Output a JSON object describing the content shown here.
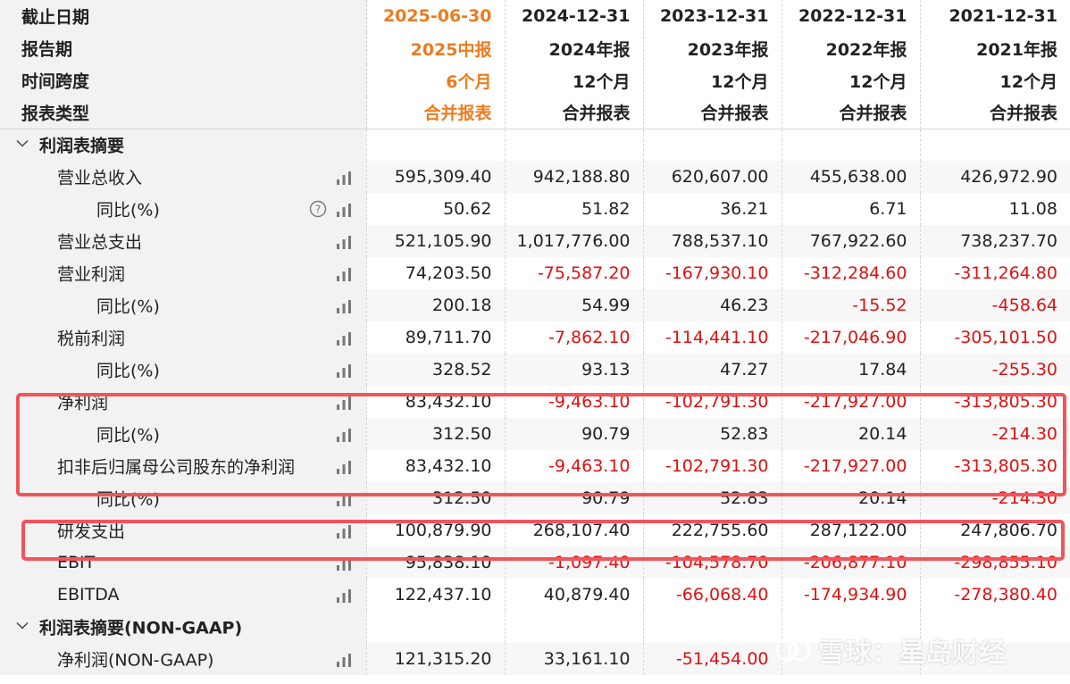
{
  "header_rows": [
    {
      "label": "截止日期",
      "values": [
        "2025-06-30",
        "2024-12-31",
        "2023-12-31",
        "2022-12-31",
        "2021-12-31"
      ]
    },
    {
      "label": "报告期",
      "values": [
        "2025中报",
        "2024年报",
        "2023年报",
        "2022年报",
        "2021年报"
      ]
    },
    {
      "label": "时间跨度",
      "values": [
        "6个月",
        "12个月",
        "12个月",
        "12个月",
        "12个月"
      ]
    },
    {
      "label": "报表类型",
      "values": [
        "合并报表",
        "合并报表",
        "合并报表",
        "合并报表",
        "合并报表"
      ]
    }
  ],
  "sections": [
    {
      "title": "利润表摘要",
      "rows": [
        {
          "label": "营业总收入",
          "level": 1,
          "values": [
            "595,309.40",
            "942,188.80",
            "620,607.00",
            "455,638.00",
            "426,972.90"
          ]
        },
        {
          "label": "同比(%)",
          "level": 2,
          "help": true,
          "values": [
            "50.62",
            "51.82",
            "36.21",
            "6.71",
            "11.08"
          ]
        },
        {
          "label": "营业总支出",
          "level": 1,
          "values": [
            "521,105.90",
            "1,017,776.00",
            "788,537.10",
            "767,922.60",
            "738,237.70"
          ]
        },
        {
          "label": "营业利润",
          "level": 1,
          "values": [
            "74,203.50",
            "-75,587.20",
            "-167,930.10",
            "-312,284.60",
            "-311,264.80"
          ]
        },
        {
          "label": "同比(%)",
          "level": 2,
          "values": [
            "200.18",
            "54.99",
            "46.23",
            "-15.52",
            "-458.64"
          ]
        },
        {
          "label": "税前利润",
          "level": 1,
          "values": [
            "89,711.70",
            "-7,862.10",
            "-114,441.10",
            "-217,046.90",
            "-305,101.50"
          ]
        },
        {
          "label": "同比(%)",
          "level": 2,
          "values": [
            "328.52",
            "93.13",
            "47.27",
            "17.84",
            "-255.30"
          ]
        },
        {
          "label": "净利润",
          "level": 1,
          "values": [
            "83,432.10",
            "-9,463.10",
            "-102,791.30",
            "-217,927.00",
            "-313,805.30"
          ]
        },
        {
          "label": "同比(%)",
          "level": 2,
          "values": [
            "312.50",
            "90.79",
            "52.83",
            "20.14",
            "-214.30"
          ]
        },
        {
          "label": "扣非后归属母公司股东的净利润",
          "level": 1,
          "values": [
            "83,432.10",
            "-9,463.10",
            "-102,791.30",
            "-217,927.00",
            "-313,805.30"
          ]
        },
        {
          "label": "同比(%)",
          "level": 2,
          "values": [
            "312.50",
            "90.79",
            "52.83",
            "20.14",
            "-214.30"
          ]
        },
        {
          "label": "研发支出",
          "level": 1,
          "values": [
            "100,879.90",
            "268,107.40",
            "222,755.60",
            "287,122.00",
            "247,806.70"
          ]
        },
        {
          "label": "EBIT",
          "level": 1,
          "values": [
            "95,838.10",
            "-1,097.40",
            "-104,578.70",
            "-206,877.10",
            "-298,855.10"
          ]
        },
        {
          "label": "EBITDA",
          "level": 1,
          "values": [
            "122,437.10",
            "40,879.40",
            "-66,068.40",
            "-174,934.90",
            "-278,380.40"
          ]
        }
      ]
    },
    {
      "title": "利润表摘要(NON-GAAP)",
      "rows": [
        {
          "label": "净利润(NON-GAAP)",
          "level": 1,
          "values": [
            "121,315.20",
            "33,161.10",
            "-51,454.00",
            "",
            ""
          ]
        }
      ]
    }
  ],
  "watermark": {
    "text": "雪球：星岛财经"
  },
  "colors": {
    "accent": "#ee7b1d",
    "negative": "#e01010",
    "highlight": "#f2545b"
  },
  "icons": {
    "bar": "bar-chart-icon",
    "help": "question-circle-icon",
    "chevron": "chevron-down-icon"
  }
}
